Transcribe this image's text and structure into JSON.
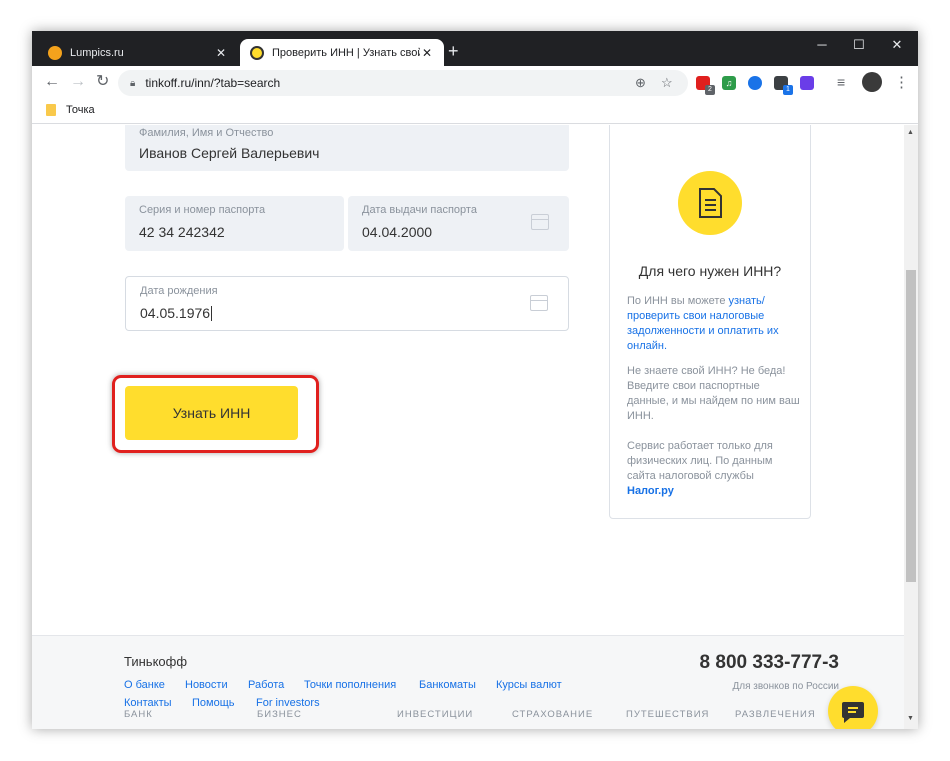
{
  "browser": {
    "tabs": [
      {
        "title": "Lumpics.ru",
        "active": false,
        "favicon_color": "#f4a21c"
      },
      {
        "title": "Проверить ИНН | Узнать свой И",
        "active": true,
        "favicon_color": "#ffdd2d"
      }
    ],
    "new_tab_symbol": "+",
    "window_controls": {
      "minimize": "─",
      "maximize": "☐",
      "close": "✕"
    },
    "url": "tinkoff.ru/inn/?tab=search",
    "bookmark": "Точка",
    "extensions": [
      {
        "name": "extension-icon",
        "color": "#e0201e",
        "badge": "2"
      },
      {
        "name": "music-extension-icon",
        "color": "#2e9c4a",
        "badge": ""
      },
      {
        "name": "globe-extension-icon",
        "color": "#1a73e8",
        "badge": ""
      },
      {
        "name": "box-extension-icon",
        "color": "#3c4043",
        "badge": "1"
      },
      {
        "name": "purple-extension-icon",
        "color": "#6a3de8",
        "badge": ""
      }
    ]
  },
  "form": {
    "full_name": {
      "label": "Фамилия, Имя и Отчество",
      "value": "Иванов Сергей Валерьевич"
    },
    "passport_number": {
      "label": "Серия и номер паспорта",
      "value": "42 34 242342"
    },
    "passport_date": {
      "label": "Дата выдачи паспорта",
      "value": "04.04.2000"
    },
    "birth_date": {
      "label": "Дата рождения",
      "value": "04.05.1976"
    },
    "submit_label": "Узнать ИНН"
  },
  "info": {
    "title": "Для чего нужен ИНН?",
    "p1_prefix": "По ИНН вы можете ",
    "p1_link": "узнать/ проверить свои налоговые задолженности и оплатить их онлайн.",
    "p2": "Не знаете свой ИНН? Не беда! Введите свои паспортные данные, и мы найдем по ним ваш ИНН.",
    "p3_prefix": "Сервис работает только для физических лиц. По данным сайта налоговой службы ",
    "p3_link": "Налог.ру"
  },
  "footer": {
    "brand": "Тинькофф",
    "links_row1": [
      "О банке",
      "Новости",
      "Работа",
      "Точки пополнения",
      "Банкоматы",
      "Курсы валют"
    ],
    "links_row2": [
      "Контакты",
      "Помощь",
      "For investors"
    ],
    "phone": "8 800 333-777-3",
    "phone_note": "Для звонков по России",
    "categories": [
      "БАНК",
      "БИЗНЕС",
      "ИНВЕСТИЦИИ",
      "СТРАХОВАНИЕ",
      "ПУТЕШЕСТВИЯ",
      "РАЗВЛЕЧЕНИЯ"
    ]
  },
  "colors": {
    "accent_yellow": "#ffdd2d",
    "link_blue": "#1771e6",
    "highlight_red": "#e0201e"
  }
}
